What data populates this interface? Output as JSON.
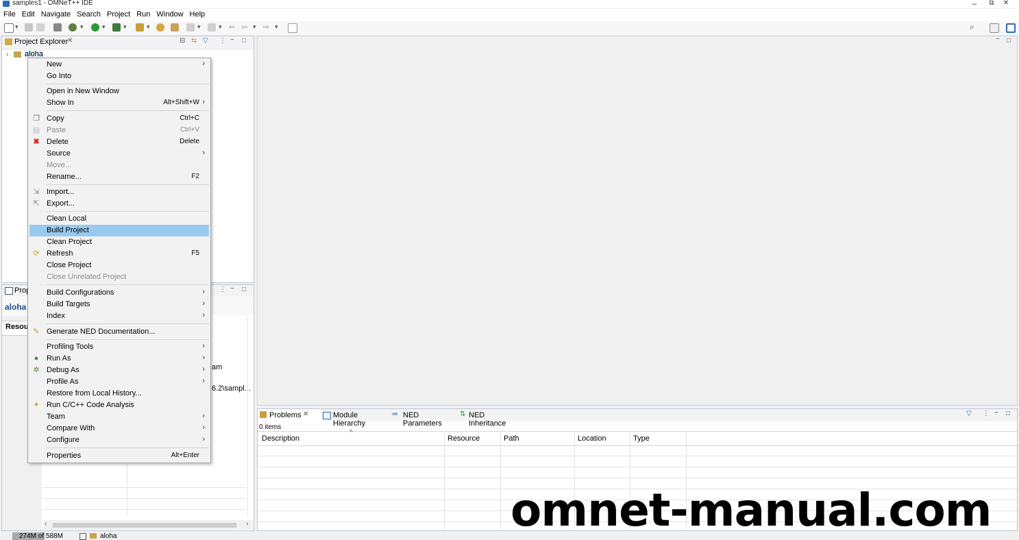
{
  "window": {
    "title": "samples1 - OMNeT++ IDE",
    "minimize": "–",
    "restore": "⧉",
    "close": "✕"
  },
  "menubar": [
    "File",
    "Edit",
    "Navigate",
    "Search",
    "Project",
    "Run",
    "Window",
    "Help"
  ],
  "project_explorer": {
    "tab_label": "Project Explorer",
    "tree_item": "aloha"
  },
  "properties": {
    "tab_label": "Prop",
    "title": "aloha",
    "subtab": "Resour",
    "frag1": "am",
    "frag2": "6.2\\sampl..."
  },
  "context_menu": {
    "items": [
      {
        "label": "New",
        "shortcut": "",
        "submenu": true
      },
      {
        "label": "Go Into",
        "shortcut": ""
      },
      {
        "label": "Open in New Window",
        "shortcut": ""
      },
      {
        "label": "Show In",
        "shortcut": "Alt+Shift+W",
        "submenu": true
      },
      {
        "label": "Copy",
        "shortcut": "Ctrl+C"
      },
      {
        "label": "Paste",
        "shortcut": "Ctrl+V",
        "disabled": true
      },
      {
        "label": "Delete",
        "shortcut": "Delete"
      },
      {
        "label": "Source",
        "shortcut": "",
        "submenu": true
      },
      {
        "label": "Move...",
        "shortcut": "",
        "disabled": true
      },
      {
        "label": "Rename...",
        "shortcut": "F2"
      },
      {
        "label": "Import...",
        "shortcut": ""
      },
      {
        "label": "Export...",
        "shortcut": ""
      },
      {
        "label": "Clean Local",
        "shortcut": ""
      },
      {
        "label": "Build Project",
        "shortcut": "",
        "selected": true
      },
      {
        "label": "Clean Project",
        "shortcut": ""
      },
      {
        "label": "Refresh",
        "shortcut": "F5"
      },
      {
        "label": "Close Project",
        "shortcut": ""
      },
      {
        "label": "Close Unrelated Project",
        "shortcut": "",
        "disabled": true
      },
      {
        "label": "Build Configurations",
        "shortcut": "",
        "submenu": true
      },
      {
        "label": "Build Targets",
        "shortcut": "",
        "submenu": true
      },
      {
        "label": "Index",
        "shortcut": "",
        "submenu": true
      },
      {
        "label": "Generate NED Documentation...",
        "shortcut": ""
      },
      {
        "label": "Profiling Tools",
        "shortcut": "",
        "submenu": true
      },
      {
        "label": "Run As",
        "shortcut": "",
        "submenu": true
      },
      {
        "label": "Debug As",
        "shortcut": "",
        "submenu": true
      },
      {
        "label": "Profile As",
        "shortcut": "",
        "submenu": true
      },
      {
        "label": "Restore from Local History...",
        "shortcut": ""
      },
      {
        "label": "Run C/C++ Code Analysis",
        "shortcut": ""
      },
      {
        "label": "Team",
        "shortcut": "",
        "submenu": true
      },
      {
        "label": "Compare With",
        "shortcut": "",
        "submenu": true
      },
      {
        "label": "Configure",
        "shortcut": "",
        "submenu": true
      },
      {
        "label": "Properties",
        "shortcut": "Alt+Enter"
      }
    ]
  },
  "problems": {
    "tabs": [
      "Problems",
      "Module Hierarchy",
      "NED Parameters",
      "NED Inheritance"
    ],
    "count": "0 items",
    "columns": [
      "Description",
      "Resource",
      "Path",
      "Location",
      "Type"
    ]
  },
  "statusbar": {
    "heap": "274M of 588M",
    "project": "aloha"
  },
  "watermark": "omnet-manual.com",
  "colors": {
    "selection": "#99c9ef",
    "accent": "#2a6db5"
  }
}
